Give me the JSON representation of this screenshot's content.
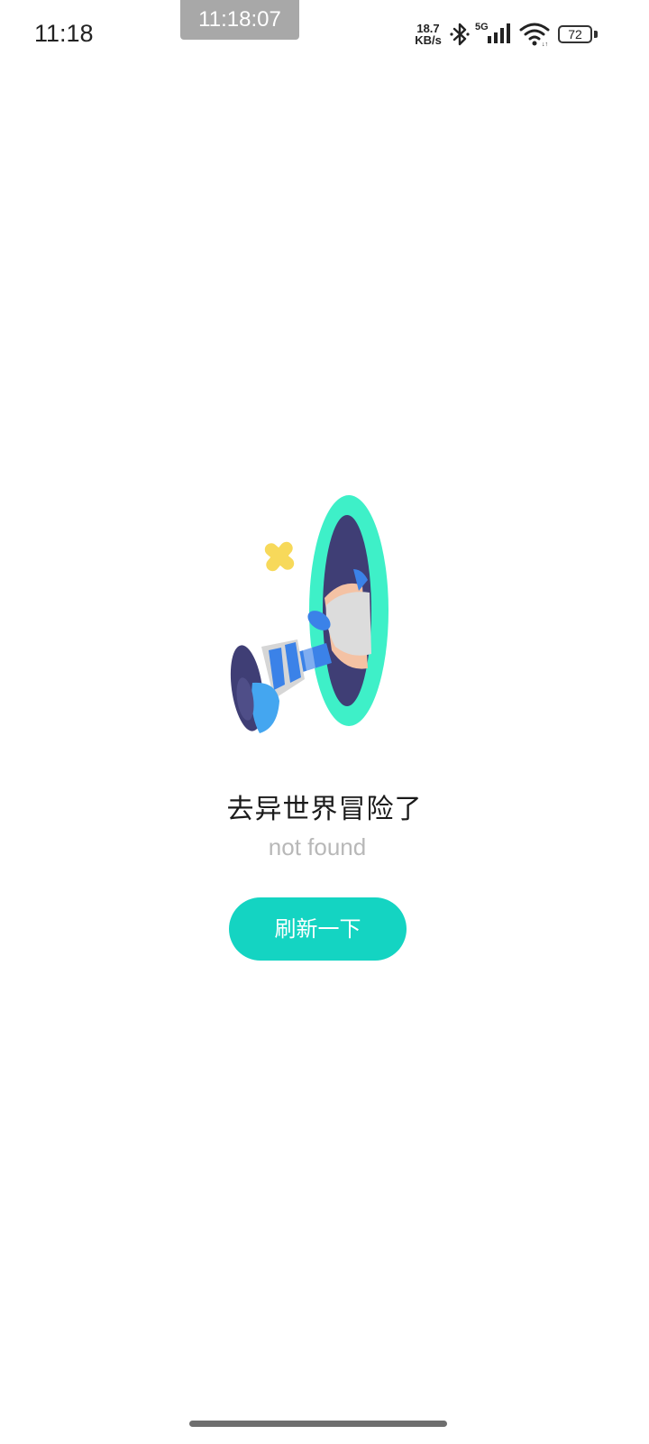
{
  "status_bar": {
    "time": "11:18",
    "clock_overlay": "11:18:07",
    "net_speed_value": "18.7",
    "net_speed_unit": "KB/s",
    "signal_label": "5G",
    "battery": "72",
    "icons": [
      "bluetooth-icon",
      "signal-icon",
      "wifi-icon",
      "battery-icon"
    ]
  },
  "error_page": {
    "title": "去异世界冒险了",
    "subtitle": "not found",
    "refresh_label": "刷新一下",
    "illustration": "portal-legs-illustration"
  },
  "colors": {
    "accent": "#14d4c2",
    "portal_ring": "#3ef0c8",
    "portal_inner": "#3f3e75",
    "sparkle": "#f7d95a",
    "shoe_blue": "#3b82e8"
  }
}
